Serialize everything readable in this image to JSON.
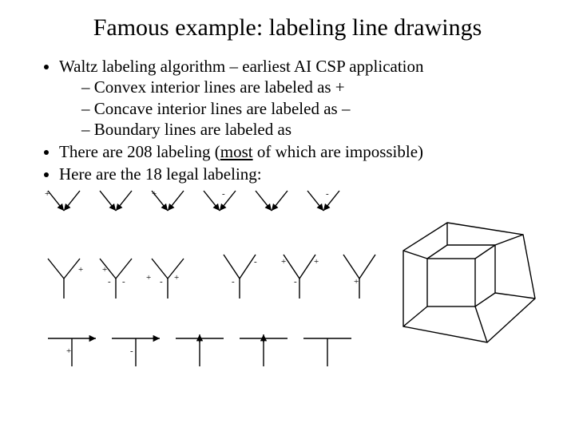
{
  "title": "Famous example: labeling line drawings",
  "bullets": {
    "b1": "Waltz labeling algorithm – earliest AI CSP application",
    "b1a": "Convex interior lines are labeled as +",
    "b1b": "Concave interior lines are labeled as –",
    "b1c": "Boundary lines are labeled as",
    "b2_pre": "There are 208 labeling (",
    "b2_u": "most",
    "b2_post": " of which are impossible)",
    "b3": "Here are the 18 legal labeling:"
  },
  "labels": {
    "r1a": "+",
    "r1c": "+",
    "r1d": "-",
    "r1f": "-",
    "r2a_r": "+",
    "r2b_l": "+",
    "r2b_ml": "-",
    "r2b_mr": "-",
    "r2c_l": "+",
    "r2c_ml": "-",
    "r2c_mr": "+",
    "r2d_t": "-",
    "r2d_m": "-",
    "r2e_tl": "+",
    "r2e_tr": "+",
    "r2e_m": "-",
    "r2f_m": "+",
    "r3a": "+",
    "r3b": "-"
  }
}
